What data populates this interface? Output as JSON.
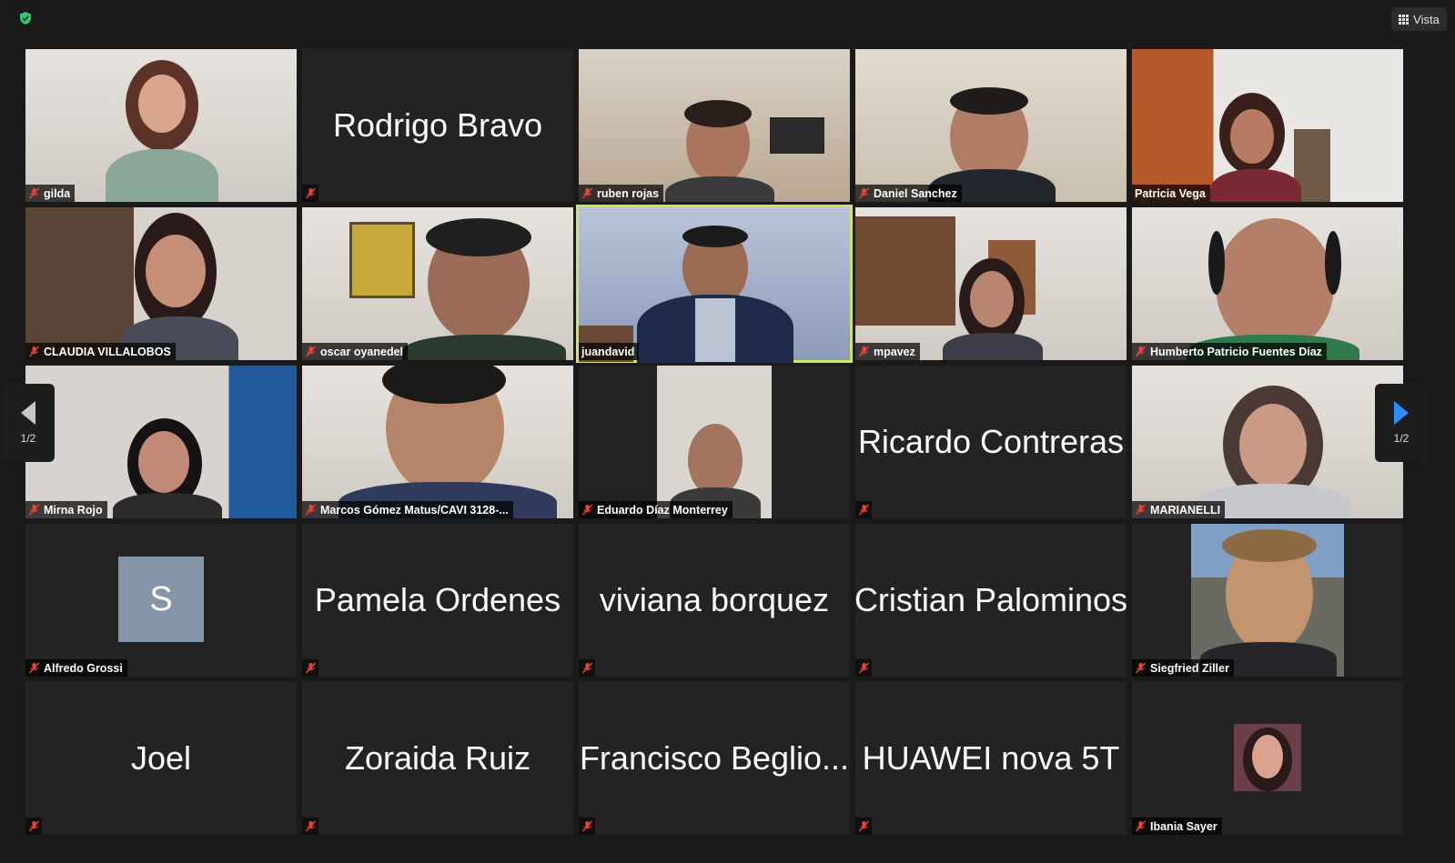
{
  "toolbar": {
    "view_label": "Vista"
  },
  "pager": {
    "left": "1/2",
    "right": "1/2"
  },
  "tiles": [
    {
      "label": "gilda"
    },
    {
      "name": "Rodrigo Bravo"
    },
    {
      "label": "ruben rojas"
    },
    {
      "label": "Daniel Sanchez"
    },
    {
      "label": "Patricia Vega"
    },
    {
      "label": "CLAUDIA VILLALOBOS"
    },
    {
      "label": "oscar oyanedel"
    },
    {
      "label": "juandavid"
    },
    {
      "label": "mpavez"
    },
    {
      "label": "Humberto Patricio Fuentes Díaz"
    },
    {
      "label": "Mirna Rojo"
    },
    {
      "label": "Marcos Gómez Matus/CAVI 3128-..."
    },
    {
      "label": "Eduardo Díaz Monterrey"
    },
    {
      "name": "Ricardo Contreras"
    },
    {
      "label": "MARIANELLI"
    },
    {
      "label": "Alfredo Grossi",
      "initial": "S"
    },
    {
      "name": "Pamela Ordenes"
    },
    {
      "name": "viviana borquez"
    },
    {
      "name": "Cristian Palominos"
    },
    {
      "label": "Siegfried Ziller"
    },
    {
      "name": "Joel"
    },
    {
      "name": "Zoraida Ruiz"
    },
    {
      "name": "Francisco Beglio..."
    },
    {
      "name": "HUAWEI nova 5T"
    },
    {
      "label": "Ibania Sayer"
    }
  ],
  "colors": {
    "active_speaker": "#cfe36a",
    "mute_icon": "#e8453c",
    "pager_arrow": "#2d8cff"
  },
  "icons": {
    "security": "shield-check-icon",
    "view": "grid-icon",
    "muted": "mic-muted-icon"
  }
}
